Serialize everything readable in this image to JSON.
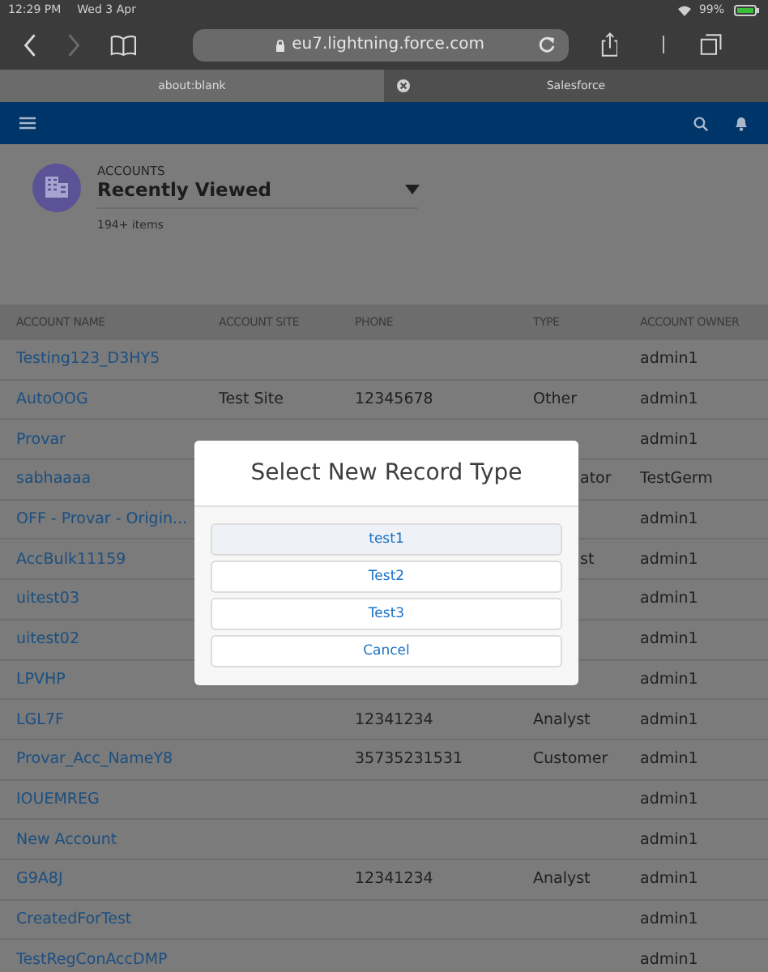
{
  "status_bar": {
    "time": "12:29 PM",
    "date": "Wed 3 Apr",
    "battery": "99%"
  },
  "browser": {
    "url": "eu7.lightning.force.com",
    "tabs": [
      {
        "label": "about:blank",
        "selected": false
      },
      {
        "label": "Salesforce",
        "selected": true
      }
    ]
  },
  "list_header": {
    "object": "ACCOUNTS",
    "view": "Recently Viewed",
    "count": "194+ items"
  },
  "table": {
    "columns": [
      "ACCOUNT NAME",
      "ACCOUNT SITE",
      "PHONE",
      "TYPE",
      "ACCOUNT OWNER"
    ],
    "rows": [
      {
        "account_name": "Testing123_D3HY5",
        "account_owner": "admin1"
      },
      {
        "account_name": "AutoOOG",
        "account_site": "Test Site",
        "phone": "12345678",
        "type": "Other",
        "account_owner": "admin1"
      },
      {
        "account_name": "Provar",
        "account_owner": "admin1"
      },
      {
        "account_name": "sabhaaaa",
        "type": "ator",
        "type_covered": true,
        "account_owner": "TestGerm"
      },
      {
        "account_name": "OFF - Provar - Origin...",
        "account_owner": "admin1"
      },
      {
        "account_name": "AccBulk11159",
        "type": "st",
        "type_covered": true,
        "account_owner": "admin1"
      },
      {
        "account_name": "uitest03",
        "account_owner": "admin1"
      },
      {
        "account_name": "uitest02",
        "account_owner": "admin1"
      },
      {
        "account_name": "LPVHP",
        "account_owner": "admin1"
      },
      {
        "account_name": "LGL7F",
        "phone": "12341234",
        "type": "Analyst",
        "account_owner": "admin1"
      },
      {
        "account_name": "Provar_Acc_NameY8",
        "phone": "35735231531",
        "type": "Customer",
        "account_owner": "admin1"
      },
      {
        "account_name": "IOUEMREG",
        "account_owner": "admin1"
      },
      {
        "account_name": "New Account",
        "account_owner": "admin1"
      },
      {
        "account_name": "G9A8J",
        "phone": "12341234",
        "type": "Analyst",
        "account_owner": "admin1"
      },
      {
        "account_name": "CreatedForTest",
        "account_owner": "admin1"
      },
      {
        "account_name": "TestRegConAccDMP",
        "account_owner": "admin1"
      }
    ]
  },
  "dialog": {
    "title": "Select New Record Type",
    "options": [
      {
        "label": "test1",
        "highlighted": true
      },
      {
        "label": "Test2",
        "highlighted": false
      },
      {
        "label": "Test3",
        "highlighted": false
      },
      {
        "label": "Cancel",
        "highlighted": false
      }
    ]
  }
}
